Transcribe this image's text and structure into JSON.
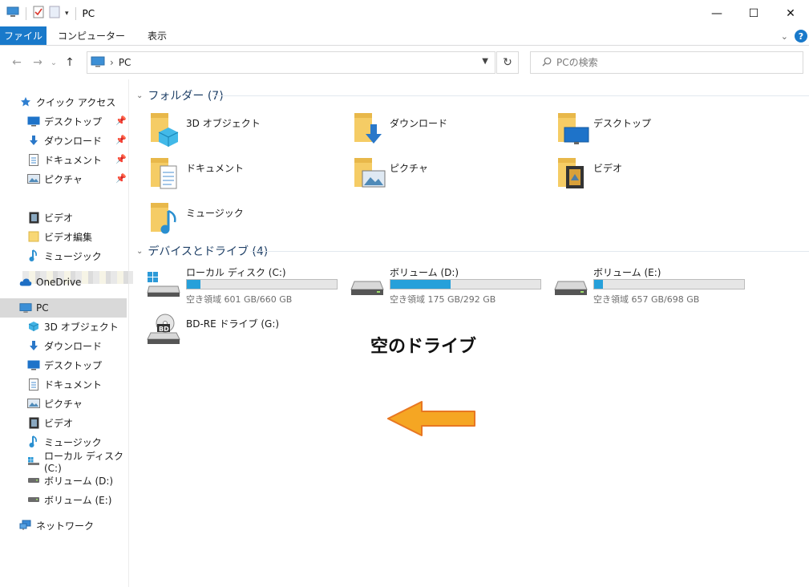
{
  "window": {
    "title": "PC",
    "controls": {
      "minimize": "—",
      "maximize": "☐",
      "close": "✕"
    }
  },
  "ribbon": {
    "tabs": [
      {
        "label": "ファイル",
        "active": true
      },
      {
        "label": "コンピューター"
      },
      {
        "label": "表示"
      }
    ],
    "help": "?"
  },
  "address": {
    "back": "←",
    "forward": "→",
    "history": "⌄",
    "up": "↑",
    "path": "PC",
    "separator": "›",
    "refresh": "↻",
    "search_placeholder": "PCの検索"
  },
  "sidebar": {
    "items": [
      {
        "label": "クイック アクセス",
        "icon": "star-icon"
      },
      {
        "label": "デスクトップ",
        "icon": "desktop-icon",
        "pinned": true
      },
      {
        "label": "ダウンロード",
        "icon": "download-icon",
        "pinned": true
      },
      {
        "label": "ドキュメント",
        "icon": "document-icon",
        "pinned": true
      },
      {
        "label": "ピクチャ",
        "icon": "pictures-icon",
        "pinned": true
      },
      {
        "label": "ビデオ",
        "icon": "video-icon"
      },
      {
        "label": "ビデオ編集",
        "icon": "folder-icon"
      },
      {
        "label": "ミュージック",
        "icon": "music-icon"
      },
      {
        "label": "OneDrive",
        "icon": "cloud-icon"
      },
      {
        "label": "PC",
        "icon": "pc-icon",
        "selected": true
      },
      {
        "label": "3D オブジェクト",
        "icon": "cube-icon"
      },
      {
        "label": "ダウンロード",
        "icon": "download-icon"
      },
      {
        "label": "デスクトップ",
        "icon": "desktop-icon"
      },
      {
        "label": "ドキュメント",
        "icon": "document-icon"
      },
      {
        "label": "ピクチャ",
        "icon": "pictures-icon"
      },
      {
        "label": "ビデオ",
        "icon": "video-icon"
      },
      {
        "label": "ミュージック",
        "icon": "music-icon"
      },
      {
        "label": "ローカル ディスク (C:)",
        "icon": "os-drive-icon"
      },
      {
        "label": "ボリューム (D:)",
        "icon": "drive-icon"
      },
      {
        "label": "ボリューム (E:)",
        "icon": "drive-icon"
      },
      {
        "label": "ネットワーク",
        "icon": "network-icon"
      }
    ]
  },
  "folders_section": {
    "header": "フォルダー (7)",
    "items": [
      {
        "label": "3D オブジェクト",
        "icon": "3d-objects-folder-icon"
      },
      {
        "label": "ダウンロード",
        "icon": "downloads-folder-icon"
      },
      {
        "label": "デスクトップ",
        "icon": "desktop-folder-icon"
      },
      {
        "label": "ドキュメント",
        "icon": "documents-folder-icon"
      },
      {
        "label": "ピクチャ",
        "icon": "pictures-folder-icon"
      },
      {
        "label": "ビデオ",
        "icon": "videos-folder-icon"
      },
      {
        "label": "ミュージック",
        "icon": "music-folder-icon"
      }
    ]
  },
  "drives_section": {
    "header": "デバイスとドライブ (4)",
    "items": [
      {
        "label": "ローカル ディスク (C:)",
        "free": "空き領域 601 GB/660 GB",
        "used_fraction": 0.09,
        "icon": "os-drive-icon"
      },
      {
        "label": "ボリューム (D:)",
        "free": "空き領域 175 GB/292 GB",
        "used_fraction": 0.4,
        "icon": "drive-icon"
      },
      {
        "label": "ボリューム (E:)",
        "free": "空き領域 657 GB/698 GB",
        "used_fraction": 0.06,
        "icon": "drive-icon"
      },
      {
        "label": "BD-RE ドライブ (G:)",
        "icon": "bd-drive-icon",
        "disc_label": "BD"
      }
    ]
  },
  "annotation": {
    "text": "空のドライブ",
    "arrow_color": "#f5a623"
  }
}
